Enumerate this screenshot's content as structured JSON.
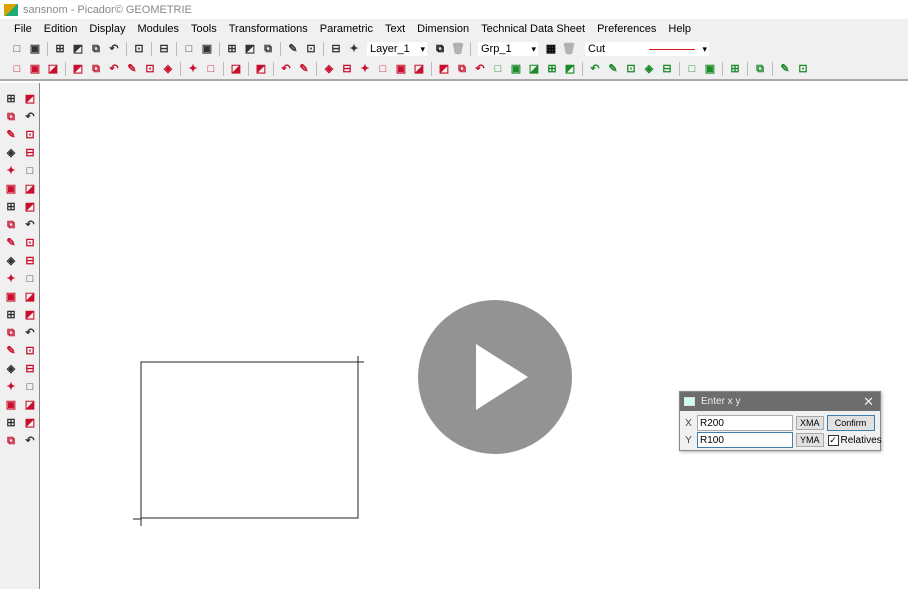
{
  "window": {
    "title": "sansnom - Picador© GEOMETRIE"
  },
  "menu": [
    "File",
    "Edition",
    "Display",
    "Modules",
    "Tools",
    "Transformations",
    "Parametric",
    "Text",
    "Dimension",
    "Technical Data Sheet",
    "Preferences",
    "Help"
  ],
  "toolbar1": {
    "icons": [
      "new-file",
      "open-folder",
      "sep",
      "import",
      "export",
      "save",
      "print-list",
      "sep",
      "settings",
      "sep",
      "add-red",
      "sep",
      "undo",
      "redo",
      "sep",
      "cut",
      "copy",
      "paste",
      "sep",
      "print-preview",
      "printer",
      "sep",
      "layers",
      "layers-disabled"
    ],
    "layer": "Layer_1",
    "group": "Grp_1",
    "line_type": "Cut",
    "line_color": "#d02020"
  },
  "toolbar2": {
    "icons": [
      "t1",
      "t2",
      "t3",
      "sep",
      "t4",
      "t5",
      "t6",
      "t7",
      "t8",
      "t9",
      "sep",
      "t10",
      "t11",
      "sep",
      "t12",
      "sep",
      "t13",
      "sep",
      "t14",
      "t15",
      "sep",
      "t16",
      "t17",
      "t18",
      "t19",
      "t20",
      "t21",
      "sep",
      "t22",
      "t23",
      "t24"
    ],
    "icons_right": [
      "dim-h",
      "dim-w",
      "dim-v",
      "dim-arc",
      "dim-multi",
      "sep",
      "arrow-up",
      "angle",
      "circle-diam",
      "radius",
      "triangle",
      "sep",
      "arrow-left",
      "arrow-check",
      "sep",
      "gear",
      "sep",
      "delete-x",
      "sep",
      "frame",
      "snap-active"
    ]
  },
  "lefttools": [
    "select-arrow",
    "zoom-window",
    "eraser",
    "delete-box",
    "multi-select",
    "move-select",
    "line",
    "polyline",
    "rectangle",
    "insert",
    "parallelogram",
    "shape",
    "vertical-line",
    "horizontal-line",
    "h-dim",
    "cross",
    "diagonal",
    "angle-line",
    "corner",
    "chamfer",
    "point",
    "v-shape",
    "mirror",
    "circle-center",
    "arc-left",
    "arc-right",
    "ellipse",
    "circle-quarter",
    "fillet",
    "window-a",
    "blocks",
    "window-b",
    "cycle",
    "gear",
    "text",
    "abc-text",
    "measure",
    "arrow-diag",
    "cut-line",
    "scissors"
  ],
  "dialog": {
    "title": "Enter x y",
    "x_label": "X",
    "y_label": "Y",
    "x_value": "R200",
    "y_value": "R100",
    "xma": "XMA",
    "yma": "YMA",
    "confirm": "Confirm",
    "relatives": "Relatives",
    "relatives_checked": true
  }
}
